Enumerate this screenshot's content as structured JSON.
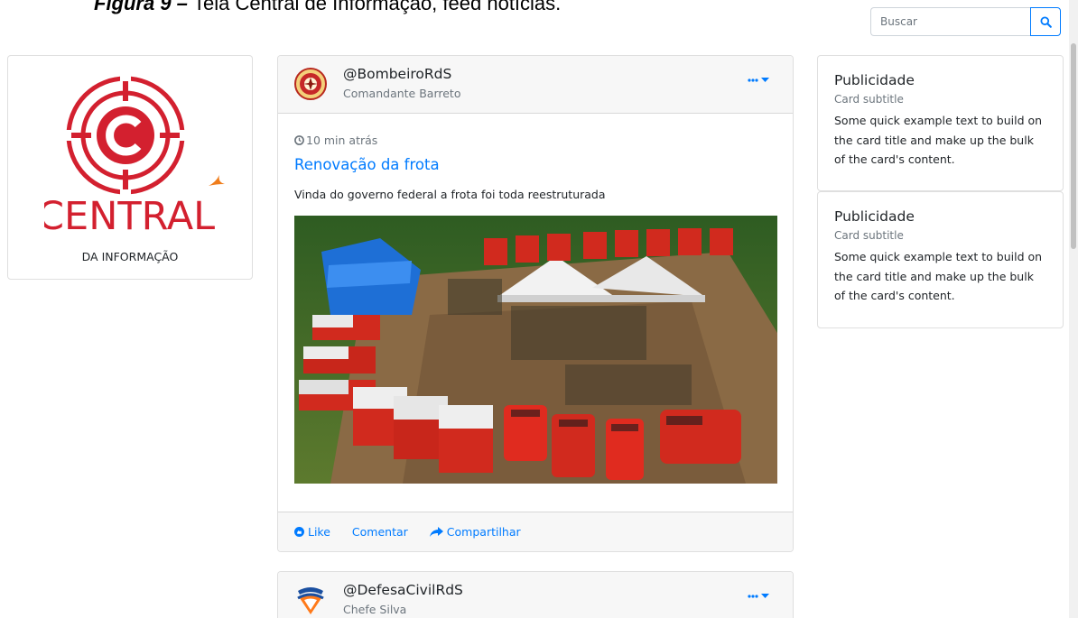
{
  "caption": {
    "prefix": "Figura 9 – ",
    "text": "Tela Central de Informação, feed notícias."
  },
  "search": {
    "placeholder": "Buscar",
    "button_icon": "search-icon"
  },
  "logo_card": {
    "logo_text": "CENTRAL",
    "subtitle": "DA INFORMAÇÃO",
    "brand_color": "#d3202f",
    "accent_color": "#f07d1b"
  },
  "posts": [
    {
      "handle": "@BombeiroRdS",
      "role": "Comandante Barreto",
      "menu_icon": "ellipsis-dropdown-icon",
      "time": "10 min atrás",
      "title": "Renovação da frota",
      "text": "Vinda do governo federal a frota foi toda reestruturada",
      "actions": {
        "like": "Like",
        "comment": "Comentar",
        "share": "Compartilhar"
      }
    },
    {
      "handle": "@DefesaCivilRdS",
      "role": "Chefe Silva",
      "menu_icon": "ellipsis-dropdown-icon"
    }
  ],
  "ads": [
    {
      "title": "Publicidade",
      "subtitle": "Card subtitle",
      "text": "Some quick example text to build on the card title and make up the bulk of the card's content."
    },
    {
      "title": "Publicidade",
      "subtitle": "Card subtitle",
      "text": "Some quick example text to build on the card title and make up the bulk of the card's content."
    }
  ],
  "colors": {
    "link": "#007bff",
    "muted": "#6c757d",
    "header_bg": "#f7f7f7"
  }
}
